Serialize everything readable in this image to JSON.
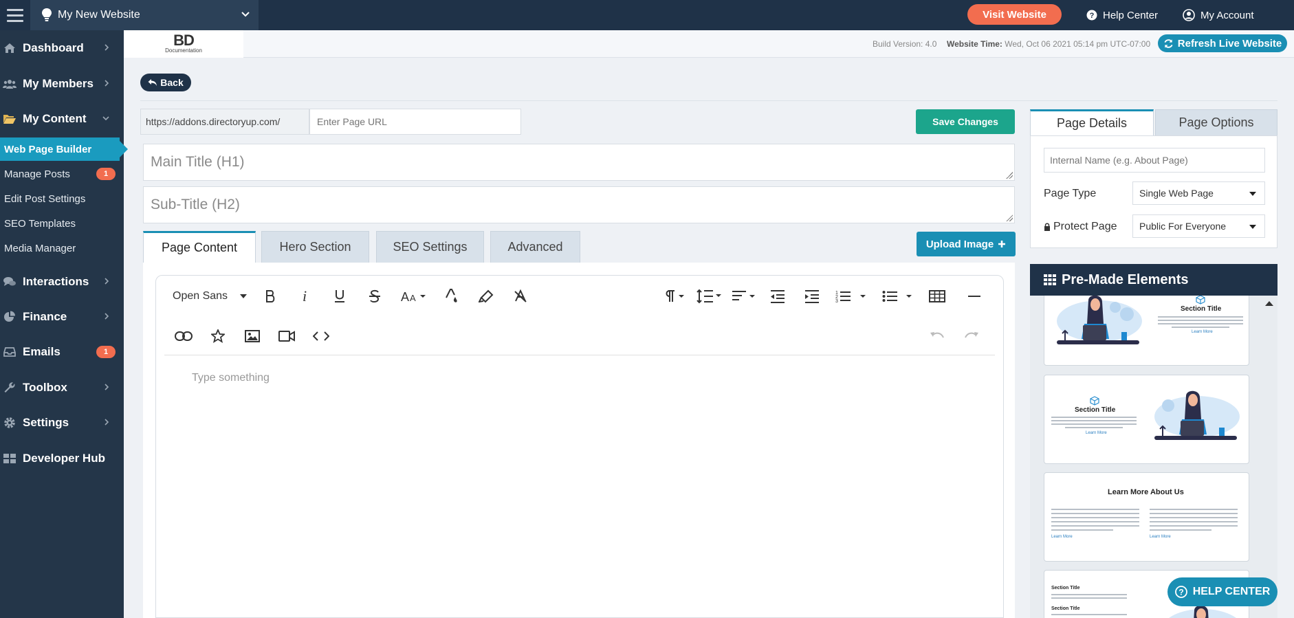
{
  "topbar": {
    "site_name": "My New Website",
    "visit_label": "Visit Website",
    "help_label": "Help Center",
    "account_label": "My Account"
  },
  "sidebar": {
    "items": [
      {
        "label": "Dashboard",
        "icon": "home-icon"
      },
      {
        "label": "My Members",
        "icon": "users-icon"
      },
      {
        "label": "My Content",
        "icon": "folder-open-icon"
      },
      {
        "label": "Interactions",
        "icon": "comments-icon"
      },
      {
        "label": "Finance",
        "icon": "pie-chart-icon"
      },
      {
        "label": "Emails",
        "icon": "inbox-icon",
        "badge": "1"
      },
      {
        "label": "Toolbox",
        "icon": "wrench-icon"
      },
      {
        "label": "Settings",
        "icon": "gear-icon"
      },
      {
        "label": "Developer Hub",
        "icon": "grid-icon"
      }
    ],
    "sub_items": [
      {
        "label": "Web Page Builder"
      },
      {
        "label": "Manage Posts",
        "badge": "1"
      },
      {
        "label": "Edit Post Settings"
      },
      {
        "label": "SEO Templates"
      },
      {
        "label": "Media Manager"
      }
    ]
  },
  "header": {
    "logo_text": "BD",
    "logo_sub": "Documentation",
    "build_version": "Build Version: 4.0",
    "website_time_label": "Website Time:",
    "website_time_value": "Wed, Oct 06 2021 05:14 pm UTC-07:00",
    "refresh_label": "Refresh Live Website"
  },
  "main": {
    "back_label": "Back",
    "url_prefix": "https://addons.directoryup.com/",
    "url_placeholder": "Enter Page URL",
    "save_label": "Save Changes",
    "title_placeholder": "Main Title (H1)",
    "subtitle_placeholder": "Sub-Title (H2)",
    "tabs": [
      {
        "label": "Page Content"
      },
      {
        "label": "Hero Section"
      },
      {
        "label": "SEO Settings"
      },
      {
        "label": "Advanced"
      }
    ],
    "upload_label": "Upload Image",
    "editor": {
      "font": "Open Sans",
      "placeholder": "Type something"
    }
  },
  "right": {
    "tabs": [
      {
        "label": "Page Details"
      },
      {
        "label": "Page Options"
      }
    ],
    "internal_name_placeholder": "Internal Name (e.g. About Page)",
    "page_type_label": "Page Type",
    "page_type_value": "Single Web Page",
    "protect_label": "Protect Page",
    "protect_value": "Public For Everyone",
    "premade_title": "Pre-Made Elements",
    "cards": [
      {
        "title": "Section Title",
        "link": "Learn More"
      },
      {
        "title": "Section Title",
        "link": "Learn More"
      },
      {
        "title": "Learn More About Us",
        "link": "Learn More"
      },
      {
        "title": "Section Title",
        "title2": "Section Title"
      }
    ]
  },
  "help_center_label": "HELP CENTER",
  "colors": {
    "navy": "#1f3248",
    "sidebar": "#243649",
    "accent_blue": "#1a8fb4",
    "orange": "#f26d4f",
    "green": "#1ca58c"
  }
}
